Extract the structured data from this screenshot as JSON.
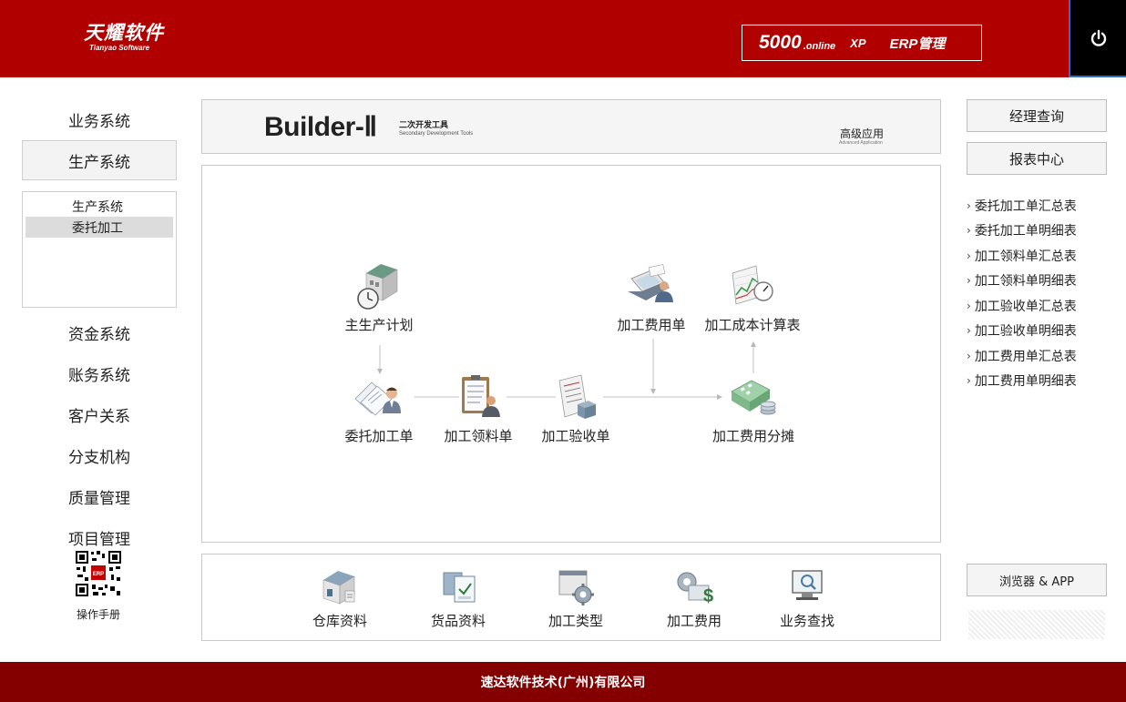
{
  "header": {
    "logo_cn": "天耀软件",
    "logo_en": "Tianyao Software",
    "badge_number": "5000",
    "badge_online": ".online",
    "badge_xp": "XP",
    "badge_erp": "ERP管理",
    "power_icon": "power-icon"
  },
  "sidebar": {
    "items_top": [
      "业务系统",
      "生产系统"
    ],
    "active_item": "生产系统",
    "sub_items": [
      "生产系统",
      "委托加工"
    ],
    "selected_sub_item": "委托加工",
    "items_bottom": [
      "资金系统",
      "账务系统",
      "客户关系",
      "分支机构",
      "质量管理",
      "项目管理"
    ],
    "manual_label": "操作手册",
    "qr_badge": "ERP"
  },
  "banner": {
    "title": "Builder-Ⅱ",
    "subtitle_cn": "二次开发工具",
    "subtitle_en": "Secondary Development Tools",
    "advanced_cn": "高级应用",
    "advanced_en": "Advanced Application"
  },
  "flow": {
    "nodes": {
      "master_plan": "主生产计划",
      "outsource_order": "委托加工单",
      "material_requisition": "加工领料单",
      "receipt_inspection": "加工验收单",
      "processing_fee_order": "加工费用单",
      "cost_calculation": "加工成本计算表",
      "fee_allocation": "加工费用分摊"
    }
  },
  "tools": [
    "仓库资料",
    "货品资料",
    "加工类型",
    "加工费用",
    "业务查找"
  ],
  "right_panel": {
    "manager_query": "经理查询",
    "report_center": "报表中心",
    "reports": [
      "委托加工单汇总表",
      "委托加工单明细表",
      "加工领料单汇总表",
      "加工领料单明细表",
      "加工验收单汇总表",
      "加工验收单明细表",
      "加工费用单汇总表",
      "加工费用单明细表"
    ],
    "browser_app": "浏览器 & APP"
  },
  "footer": {
    "company": "速达软件技术(广州)有限公司"
  },
  "colors": {
    "header_red": "#b00000",
    "footer_red": "#840000",
    "power_bg": "#000000",
    "power_border": "#2c6fd1"
  }
}
